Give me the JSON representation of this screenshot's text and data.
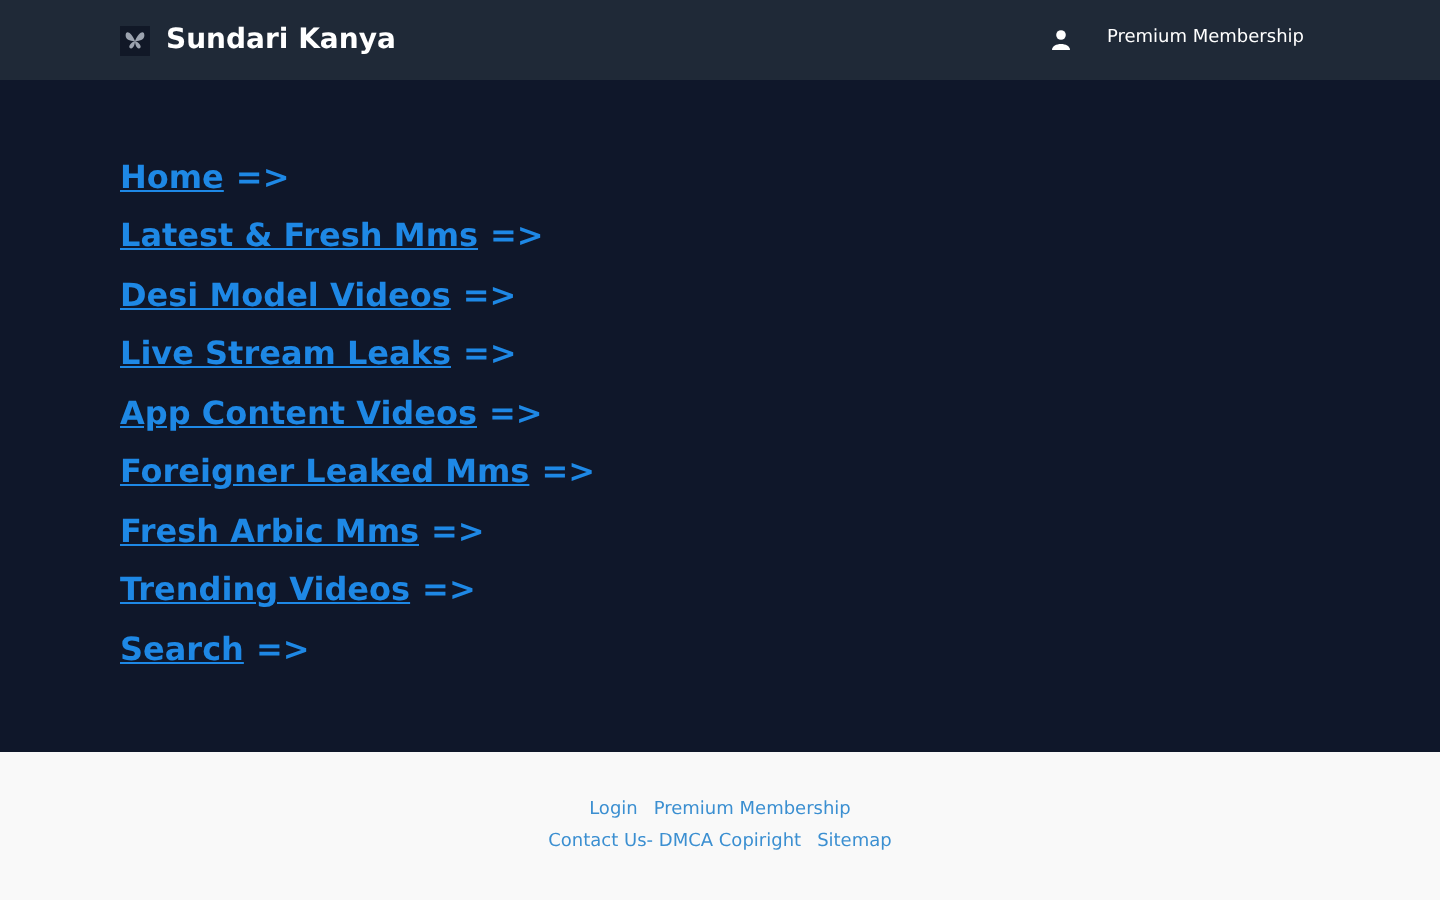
{
  "header": {
    "site_name": "Sundari Kanya",
    "membership_link": "Premium Membership"
  },
  "menu": [
    {
      "label": "Home",
      "arrow": "=>"
    },
    {
      "label": "Latest & Fresh Mms",
      "arrow": "=>"
    },
    {
      "label": "Desi Model Videos",
      "arrow": "=>"
    },
    {
      "label": "Live Stream Leaks",
      "arrow": "=>"
    },
    {
      "label": "App Content Videos",
      "arrow": "=>"
    },
    {
      "label": "Foreigner Leaked Mms",
      "arrow": "=>"
    },
    {
      "label": "Fresh Arbic Mms",
      "arrow": "=>"
    },
    {
      "label": "Trending Videos",
      "arrow": "=>"
    },
    {
      "label": "Search",
      "arrow": "=>"
    }
  ],
  "footer": {
    "links_row_1": [
      "Login",
      "Premium Membership"
    ],
    "links_row_2": [
      "Contact Us- DMCA Copiright",
      "Sitemap"
    ]
  }
}
